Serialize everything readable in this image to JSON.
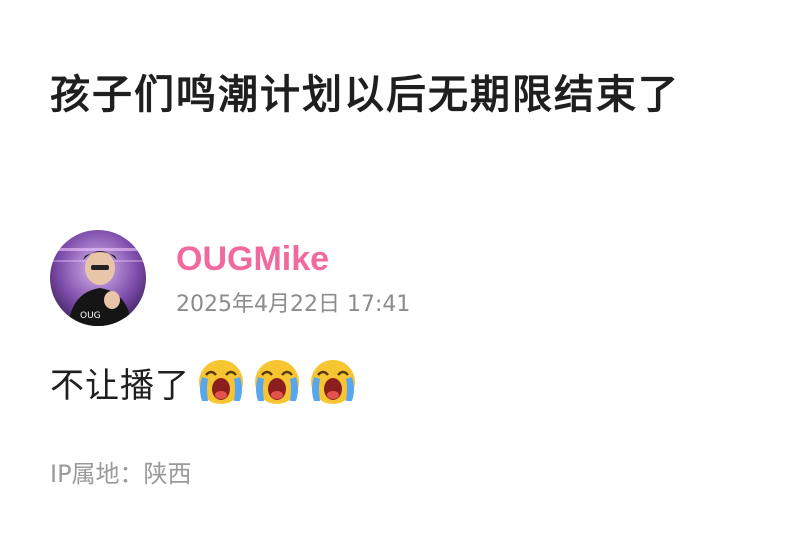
{
  "post": {
    "title": "孩子们鸣潮计划以后无期限结束了",
    "author": {
      "name": "OUGMike",
      "avatar_icon": "user-avatar-photo"
    },
    "time": "2025年4月22日 17:41",
    "body": {
      "text": "不让播了",
      "emojis": [
        "loudly-crying-face-icon",
        "loudly-crying-face-icon",
        "loudly-crying-face-icon"
      ]
    },
    "ip_location": "IP属地：陕西"
  },
  "colors": {
    "author_name": "#f06a9f",
    "title_text": "#1f1f1f",
    "meta_text": "#8c8c8c"
  }
}
